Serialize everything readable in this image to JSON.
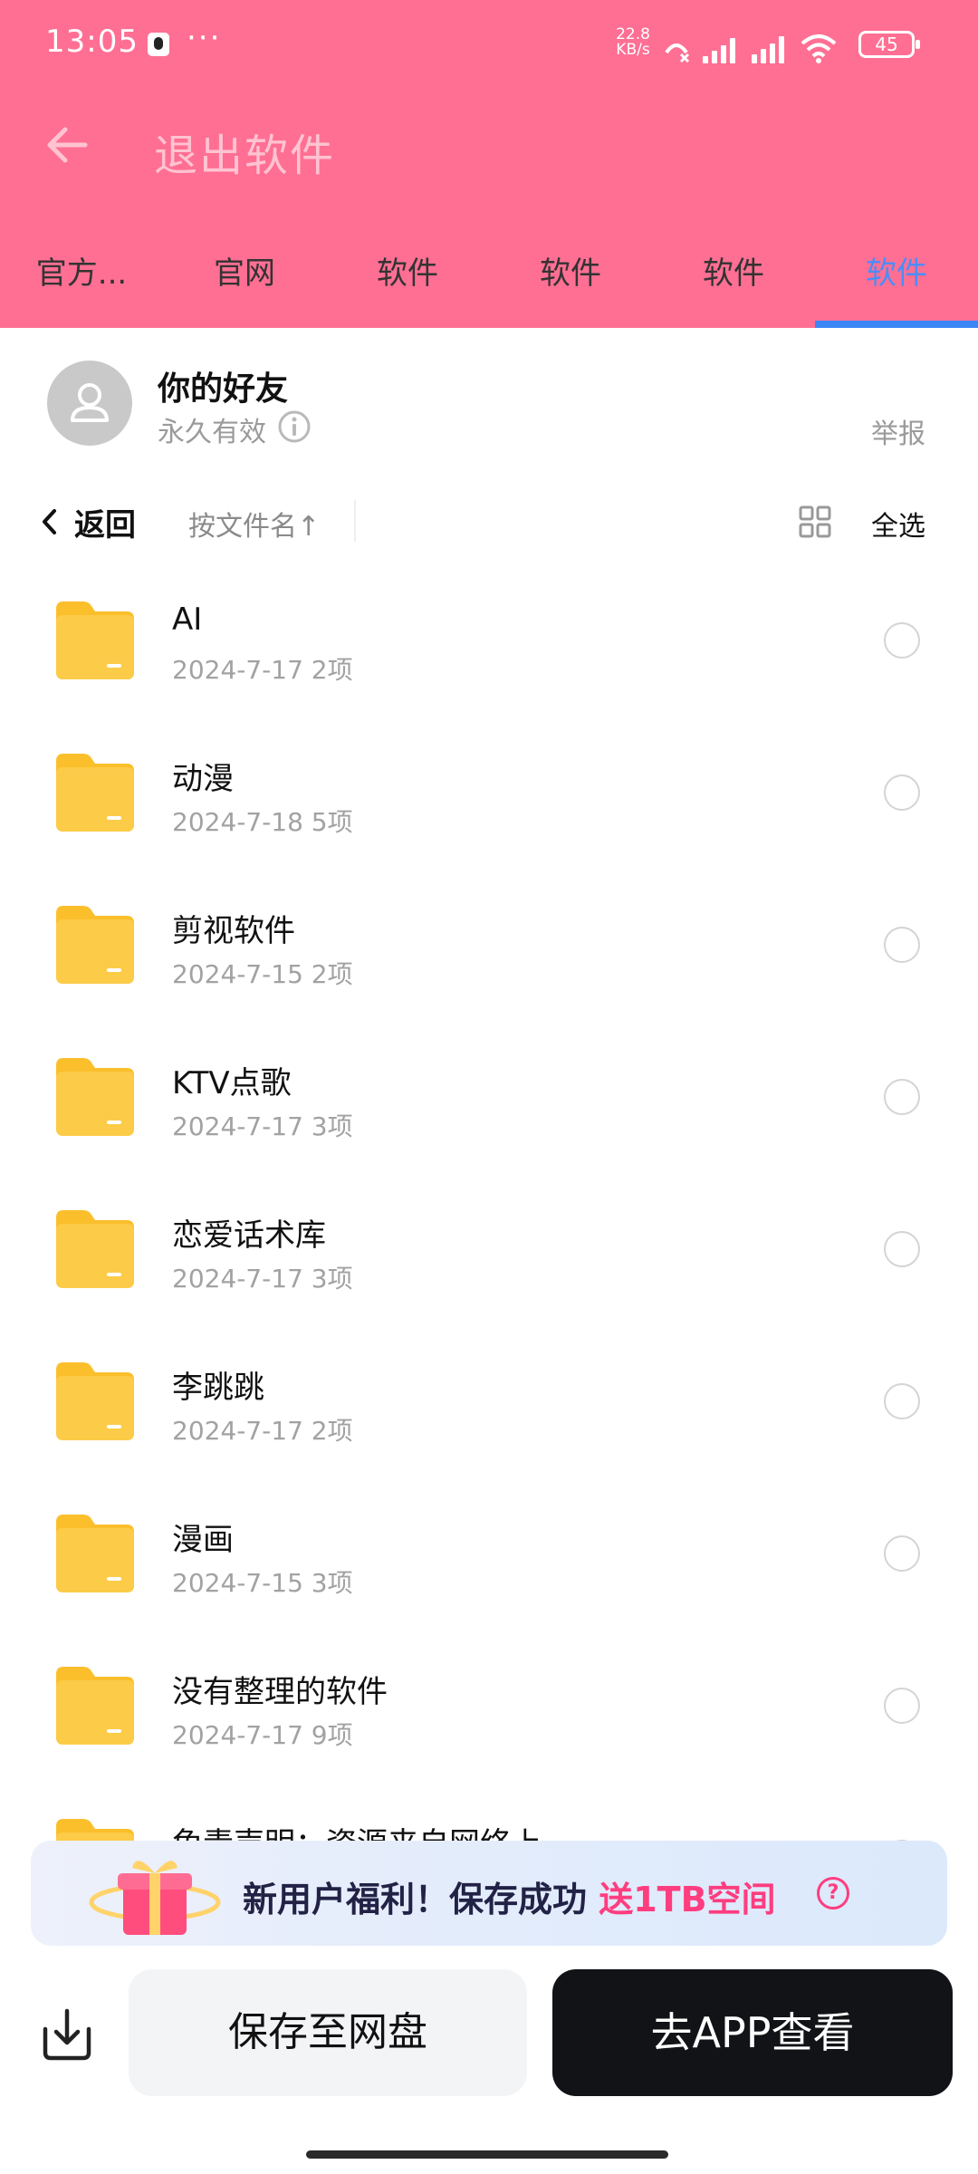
{
  "status_bar": {
    "time": "13:05",
    "dots": "···",
    "speed_value": "22.8",
    "speed_unit": "KB/s",
    "battery": "45"
  },
  "header": {
    "title": "退出软件",
    "tabs": [
      {
        "label": "官方..."
      },
      {
        "label": "官网"
      },
      {
        "label": "软件"
      },
      {
        "label": "软件"
      },
      {
        "label": "软件"
      },
      {
        "label": "软件",
        "active": true
      }
    ]
  },
  "sharer": {
    "name": "你的好友",
    "validity": "永久有效",
    "report": "举报"
  },
  "toolbar": {
    "back": "返回",
    "sort": "按文件名↑",
    "select_all": "全选"
  },
  "files": [
    {
      "name": "AI",
      "meta": "2024-7-17  2项"
    },
    {
      "name": "动漫",
      "meta": "2024-7-18  5项"
    },
    {
      "name": "剪视软件",
      "meta": "2024-7-15  2项"
    },
    {
      "name": "KTV点歌",
      "meta": "2024-7-17  3项"
    },
    {
      "name": "恋爱话术库",
      "meta": "2024-7-17  3项"
    },
    {
      "name": "李跳跳",
      "meta": "2024-7-17  2项"
    },
    {
      "name": "漫画",
      "meta": "2024-7-15  3项"
    },
    {
      "name": "没有整理的软件",
      "meta": "2024-7-17  9项"
    },
    {
      "name": "免责声明：资源来自网络上",
      "meta": ""
    }
  ],
  "promo": {
    "text_before": "新用户福利！保存成功 ",
    "text_highlight": "送1TB空间",
    "help": "?"
  },
  "bottom_bar": {
    "save": "保存至网盘",
    "open_app": "去APP查看"
  },
  "colors": {
    "header_bg": "#ff6f93",
    "tab_active": "#4a8df8",
    "folder": "#fbbf2c",
    "promo_highlight": "#ff3d7f",
    "app_button": "#111317"
  }
}
